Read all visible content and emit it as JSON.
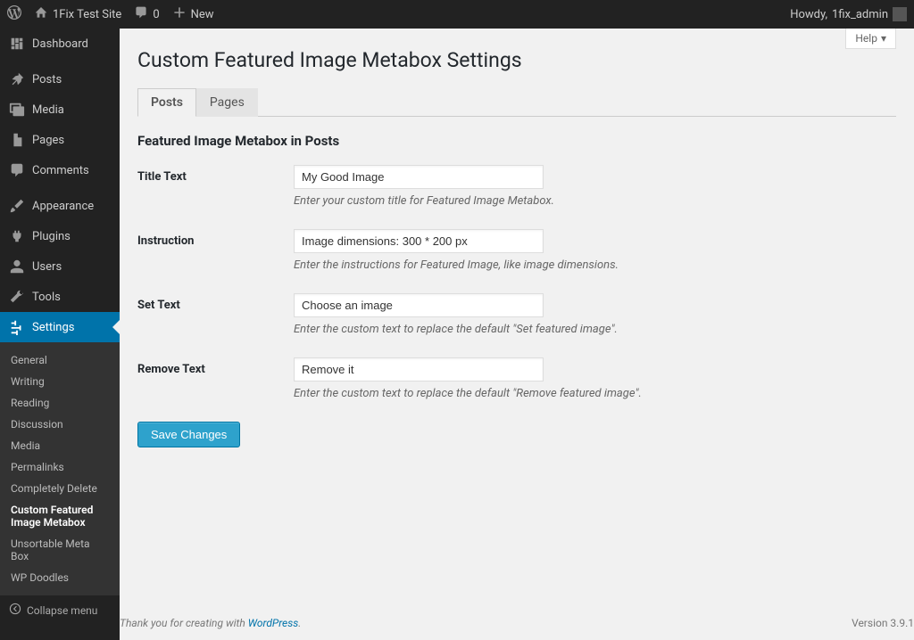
{
  "adminbar": {
    "site_name": "1Fix Test Site",
    "comments_count": "0",
    "new_label": "New",
    "howdy_prefix": "Howdy,",
    "username": "1fix_admin"
  },
  "sidebar": {
    "items": [
      {
        "label": "Dashboard",
        "icon": "dashboard"
      },
      {
        "label": "Posts",
        "icon": "pin"
      },
      {
        "label": "Media",
        "icon": "media"
      },
      {
        "label": "Pages",
        "icon": "pages"
      },
      {
        "label": "Comments",
        "icon": "bubble"
      },
      {
        "label": "Appearance",
        "icon": "brush"
      },
      {
        "label": "Plugins",
        "icon": "plug"
      },
      {
        "label": "Users",
        "icon": "user"
      },
      {
        "label": "Tools",
        "icon": "wrench"
      },
      {
        "label": "Settings",
        "icon": "sliders",
        "current": true
      }
    ],
    "submenu": [
      {
        "label": "General"
      },
      {
        "label": "Writing"
      },
      {
        "label": "Reading"
      },
      {
        "label": "Discussion"
      },
      {
        "label": "Media"
      },
      {
        "label": "Permalinks"
      },
      {
        "label": "Completely Delete"
      },
      {
        "label": "Custom Featured Image Metabox",
        "current": true
      },
      {
        "label": "Unsortable Meta Box"
      },
      {
        "label": "WP Doodles"
      }
    ],
    "collapse_label": "Collapse menu"
  },
  "content": {
    "help_label": "Help",
    "page_title": "Custom Featured Image Metabox Settings",
    "tabs": [
      {
        "label": "Posts",
        "active": true
      },
      {
        "label": "Pages"
      }
    ],
    "section_title": "Featured Image Metabox in Posts",
    "fields": {
      "title_text": {
        "label": "Title Text",
        "value": "My Good Image",
        "desc": "Enter your custom title for Featured Image Metabox."
      },
      "instruction": {
        "label": "Instruction",
        "value": "Image dimensions: 300 * 200 px",
        "desc": "Enter the instructions for Featured Image, like image dimensions."
      },
      "set_text": {
        "label": "Set Text",
        "value": "Choose an image",
        "desc": "Enter the custom text to replace the default \"Set featured image\"."
      },
      "remove_text": {
        "label": "Remove Text",
        "value": "Remove it",
        "desc": "Enter the custom text to replace the default \"Remove featured image\"."
      }
    },
    "save_label": "Save Changes"
  },
  "footer": {
    "thank_prefix": "Thank you for creating with ",
    "wp_link": "WordPress",
    "thank_suffix": ".",
    "version_label": "Version 3.9.1"
  }
}
